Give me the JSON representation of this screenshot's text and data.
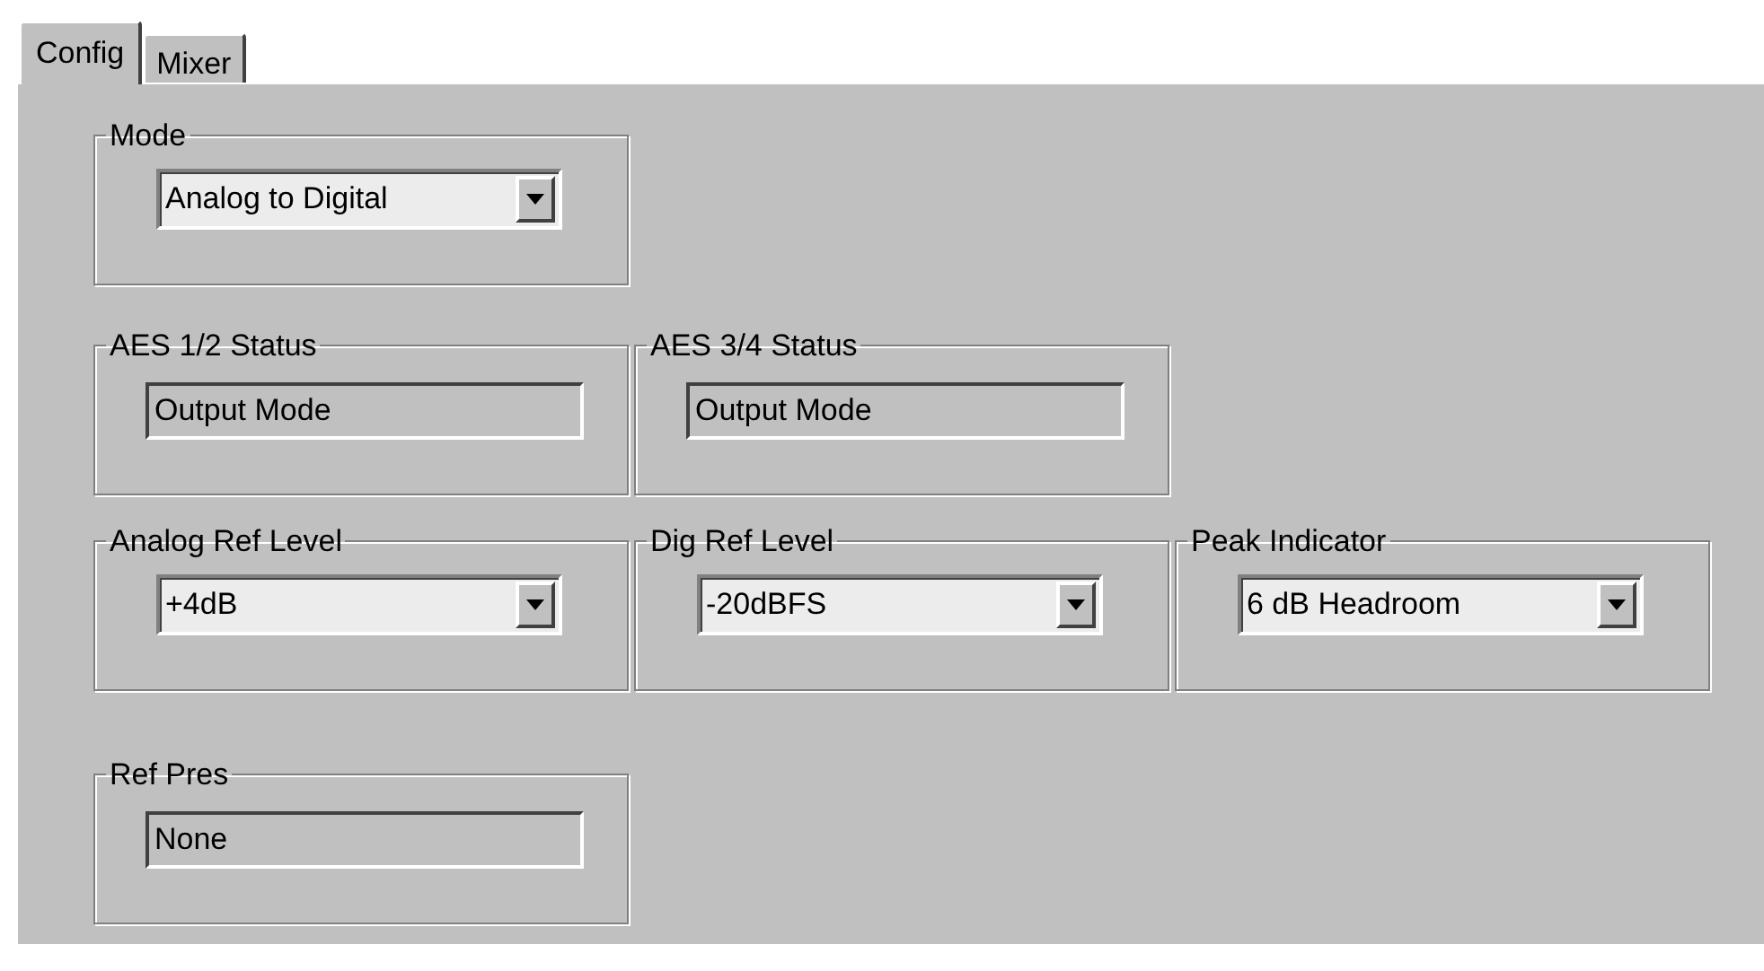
{
  "tabs": [
    {
      "label": "Config",
      "selected": true
    },
    {
      "label": "Mixer",
      "selected": false
    }
  ],
  "rows": [
    [
      {
        "title": "Mode",
        "kind": "dropdown",
        "value": "Analog to Digital"
      }
    ],
    [
      {
        "title": "AES 1/2 Status",
        "kind": "readout",
        "value": "Output Mode"
      },
      {
        "title": "AES 3/4 Status",
        "kind": "readout",
        "value": "Output Mode"
      }
    ],
    [
      {
        "title": "Analog Ref Level",
        "kind": "dropdown",
        "value": "+4dB"
      },
      {
        "title": "Dig Ref Level",
        "kind": "dropdown",
        "value": "-20dBFS"
      },
      {
        "title": "Peak Indicator",
        "kind": "dropdown",
        "value": "6 dB Headroom"
      }
    ],
    [
      {
        "title": "Ref Pres",
        "kind": "readout",
        "value": "None"
      }
    ]
  ]
}
